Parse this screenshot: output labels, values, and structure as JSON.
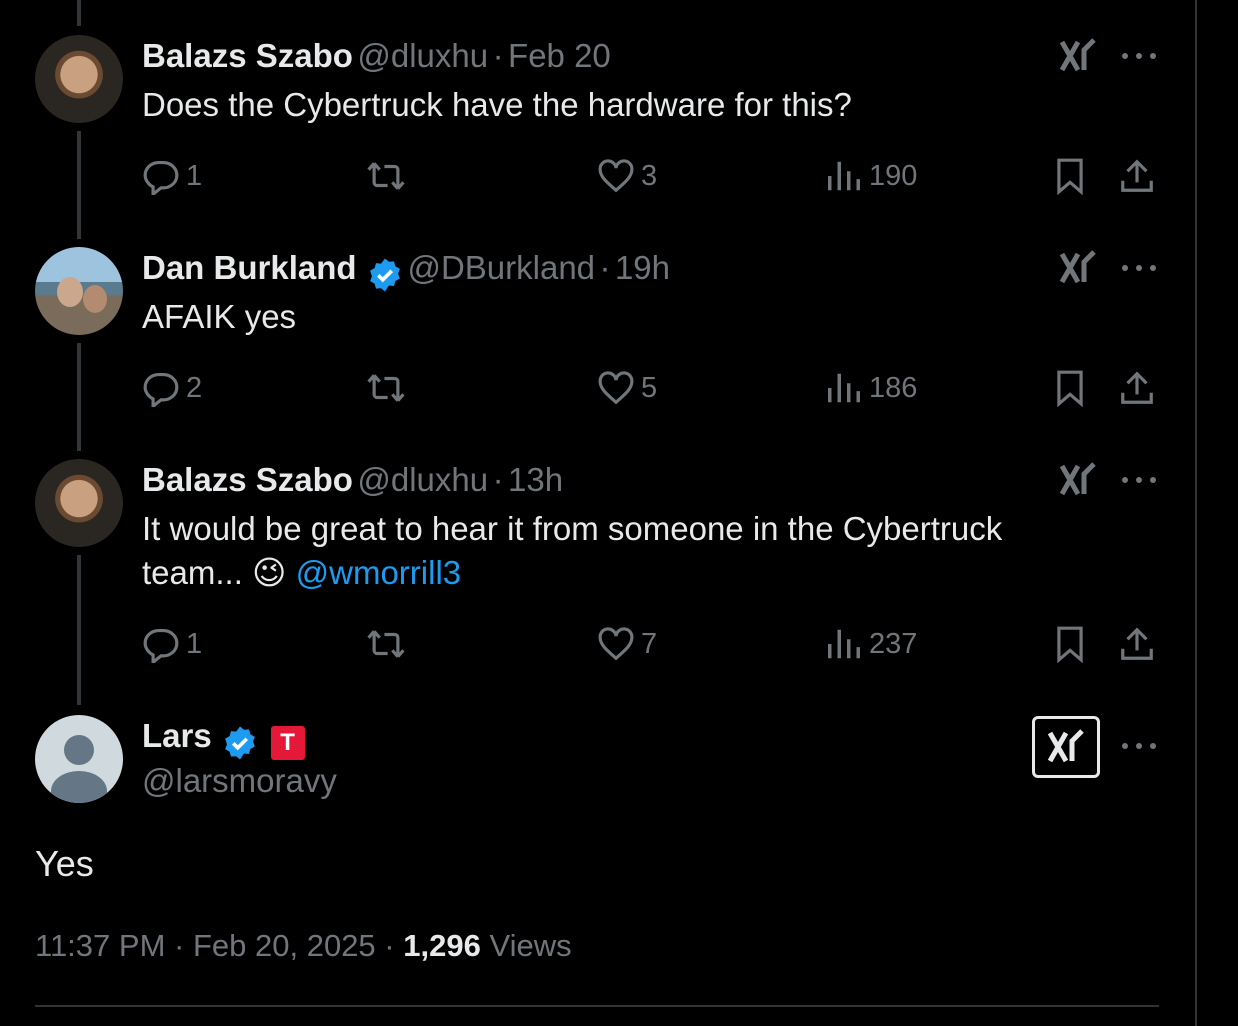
{
  "tweets": [
    {
      "name": "Balazs Szabo",
      "handle": "@dluxhu",
      "sep": "·",
      "time": "Feb 20",
      "text": "Does the Cybertruck have the hardware for this?",
      "replies": "1",
      "likes": "3",
      "views": "190"
    },
    {
      "name": "Dan Burkland",
      "handle": "@DBurkland",
      "sep": "·",
      "time": "19h",
      "text": "AFAIK yes",
      "replies": "2",
      "likes": "5",
      "views": "186"
    },
    {
      "name": "Balazs Szabo",
      "handle": "@dluxhu",
      "sep": "·",
      "time": "13h",
      "text_line1": "It would be great to hear it from someone in the Cybertruck",
      "text_line2": "team... ",
      "emoji": "😉",
      "mention": "@wmorrill3",
      "replies": "1",
      "likes": "7",
      "views": "237"
    }
  ],
  "main_tweet": {
    "name": "Lars",
    "badge": "T",
    "handle": "@larsmoravy",
    "text": "Yes",
    "time": "11:37 PM",
    "sep1": "·",
    "date": "Feb 20, 2025",
    "sep2": "·",
    "views_count": "1,296",
    "views_label": "Views"
  },
  "icons": {
    "reply": "reply-icon",
    "retweet": "retweet-icon",
    "like": "heart-icon",
    "views": "analytics-icon",
    "bookmark": "bookmark-icon",
    "share": "share-icon",
    "grok": "grok-icon",
    "more": "more-icon",
    "verified": "verified-badge-icon"
  },
  "colors": {
    "background": "#000000",
    "text": "#e7e9ea",
    "muted": "#71767b",
    "accent": "#1d9bf0",
    "tesla": "#e31937"
  }
}
